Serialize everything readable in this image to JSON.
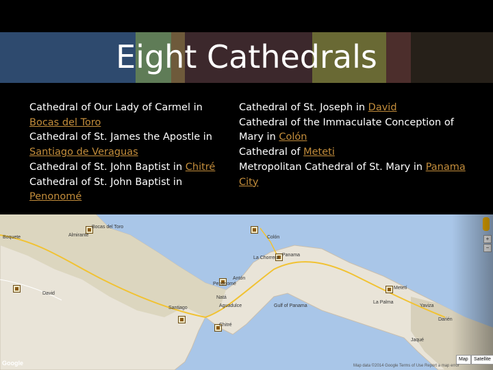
{
  "slide": {
    "title": "Eight Cathedrals",
    "left_column": [
      {
        "text": "Cathedral of Our Lady of Carmel in ",
        "link": "Bocas del Toro"
      },
      {
        "text": "Cathedral of St. James the Apostle in ",
        "link": "Santiago de Veraguas"
      },
      {
        "text": "Cathedral of St. John Baptist in ",
        "link": "Chitré"
      },
      {
        "text": "Cathedral of St. John Baptist in ",
        "link": "Penonomé"
      }
    ],
    "right_column": [
      {
        "text": "Cathedral of St. Joseph in ",
        "link": "David"
      },
      {
        "text": "Cathedral of the Immaculate Conception of Mary in ",
        "link": "Colón"
      },
      {
        "text": "Cathedral of ",
        "link": "Meteti"
      },
      {
        "text": "Metropolitan Cathedral of St. Mary in ",
        "link": "Panama City"
      }
    ],
    "link_color": "#c38d3b",
    "stripe_colors": [
      "#2f4c70",
      "#5b7a5a",
      "#6f5b3a",
      "#3e2a2f",
      "#6b6b32",
      "#4a2c2c"
    ]
  },
  "map": {
    "labels": {
      "bocas": "Bocas del Toro",
      "almirante": "Almirante",
      "david": "David",
      "boquete": "Boquete",
      "penonome": "Penonomé",
      "nata": "Natá",
      "aguadulce": "Aguadulce",
      "santiago": "Santiago",
      "chitre": "Chitré",
      "panama": "Panama",
      "colon": "Colón",
      "arraijan": "La Chorrera",
      "gulf": "Gulf of Panama",
      "meteti": "Metetí",
      "yaviza": "Yaviza",
      "jaque": "Jaqué",
      "darien": "Darién",
      "la_palma": "La Palma",
      "anton": "Antón"
    },
    "google": "Google",
    "map_button": "Map",
    "satellite_button": "Satellite",
    "attribution": "Map data ©2014 Google   Terms of Use   Report a map error",
    "zoom_in": "+",
    "zoom_out": "−"
  }
}
